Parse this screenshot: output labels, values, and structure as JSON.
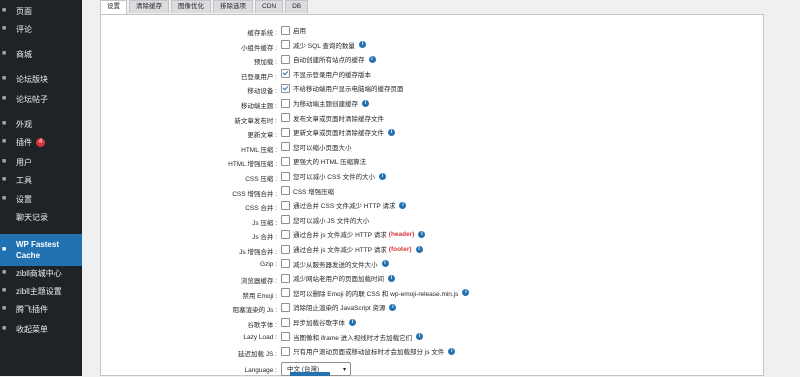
{
  "sidebar": {
    "items": [
      {
        "label": "页面",
        "icon": "page-icon"
      },
      {
        "label": "评论",
        "icon": "comment-icon"
      },
      {
        "label": "商城",
        "icon": "shop-icon"
      },
      {
        "label": "论坛版块",
        "icon": "forum-icon"
      },
      {
        "label": "论坛帖子",
        "icon": "forum-post-icon"
      },
      {
        "label": "外观",
        "icon": "appearance-icon"
      },
      {
        "label": "插件",
        "icon": "plugin-icon",
        "badge": "4"
      },
      {
        "label": "用户",
        "icon": "user-icon"
      },
      {
        "label": "工具",
        "icon": "tool-icon"
      },
      {
        "label": "设置",
        "icon": "settings-icon"
      },
      {
        "label": "聊天记录",
        "icon": ""
      },
      {
        "label": "WP Fastest Cache",
        "icon": "cache-icon",
        "active": true
      },
      {
        "label": "zibll商城中心",
        "icon": "gear-icon"
      },
      {
        "label": "zibll主题设置",
        "icon": "gear-icon"
      },
      {
        "label": "腾飞插件",
        "icon": "plugin-gear-icon"
      },
      {
        "label": "收起菜单",
        "icon": "collapse-icon"
      }
    ]
  },
  "tabs": [
    "设置",
    "清除缓存",
    "图像优化",
    "排除选项",
    "CDN",
    "DB"
  ],
  "settings": [
    {
      "label": "缓存系统 :",
      "text": "启用",
      "checked": false,
      "info": false
    },
    {
      "label": "小组件缓存 :",
      "text": "减少 SQL 查询的数量",
      "checked": false,
      "info": true
    },
    {
      "label": "预加载 :",
      "text": "自动创建所有站点的缓存",
      "checked": false,
      "info": true
    },
    {
      "label": "已登录用户 :",
      "text": "不显示登录用户的缓存版本",
      "checked": true,
      "info": false
    },
    {
      "label": "移动设备 :",
      "text": "不给移动端用户显示电脑端的缓存页面",
      "checked": true,
      "info": false
    },
    {
      "label": "移动端主题 :",
      "text": "为移动端主题创建缓存",
      "checked": false,
      "info": true
    },
    {
      "label": "新文章发布时 :",
      "text": "发布文章或页面时清除缓存文件",
      "checked": false,
      "info": false
    },
    {
      "label": "更新文章 :",
      "text": "更新文章或页面时清除缓存文件",
      "checked": false,
      "info": true
    },
    {
      "label": "HTML 压缩 :",
      "text": "您可以缩小页面大小",
      "checked": false,
      "info": false
    },
    {
      "label": "HTML 增强压缩 :",
      "text": "更强大的 HTML 压缩算法",
      "checked": false,
      "info": false
    },
    {
      "label": "CSS 压缩 :",
      "text": "您可以减小 CSS 文件的大小",
      "checked": false,
      "info": true
    },
    {
      "label": "CSS 增强合并 :",
      "text": "CSS 增强压缩",
      "checked": false,
      "info": false
    },
    {
      "label": "CSS 合并 :",
      "text": "通过合并 CSS 文件减少 HTTP 请求",
      "checked": false,
      "info": true
    },
    {
      "label": "Js 压缩 :",
      "text": "您可以减小 JS 文件的大小",
      "checked": false,
      "info": false
    },
    {
      "label": "Js 合并 :",
      "text": "通过合并 js 文件减少 HTTP 请求",
      "red": "(header)",
      "checked": false,
      "info": true
    },
    {
      "label": "Js 增强合并 :",
      "text": "通过合并 js 文件减少 HTTP 请求",
      "red": "(footer)",
      "checked": false,
      "info": true
    },
    {
      "label": "Gzip :",
      "text": "减少从服务器发送的文件大小",
      "checked": false,
      "info": true
    },
    {
      "label": "浏览器缓存 :",
      "text": "减少网站老用户的页面加载时间",
      "checked": false,
      "info": true
    },
    {
      "label": "禁用 Emoji :",
      "text": "您可以删除 Emoji 的内联 CSS 和 wp-emoji-release.min.js",
      "checked": false,
      "info": true
    },
    {
      "label": "阻塞渲染的 Js :",
      "text": "消除阻止渲染的 JavaScript 资源",
      "checked": false,
      "info": true
    },
    {
      "label": "谷歌字体 :",
      "text": "异步加载谷歌字体",
      "checked": false,
      "info": true
    },
    {
      "label": "Lazy Load :",
      "text": "当图像和 iframe 进入视线时才去加载它们",
      "checked": false,
      "info": true
    },
    {
      "label": "延迟加载 JS :",
      "text": "只有用户滚动页面或移动鼠标时才会加载部分 js 文件",
      "checked": false,
      "info": true
    }
  ],
  "language": {
    "label": "Language :",
    "value": "中文 (台灣)"
  },
  "colors": {
    "sidebar_bg": "#1d2327",
    "accent": "#2271b1",
    "badge": "#d63638"
  }
}
